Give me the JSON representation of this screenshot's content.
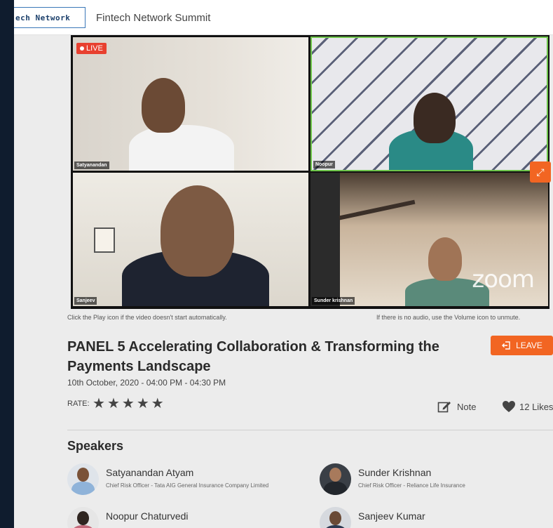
{
  "header": {
    "logo_text": "ech Network",
    "summit_title": "Fintech Network Summit"
  },
  "video": {
    "live_label": "LIVE",
    "zoom_watermark": "zoom",
    "tiles": [
      {
        "name": "Satyanandan"
      },
      {
        "name": "Noopur"
      },
      {
        "name": "Sanjeev"
      },
      {
        "name": "Sunder krishnan"
      }
    ],
    "active_speaker_color": "#6ec54a"
  },
  "hints": {
    "play": "Click the Play icon if the video doesn't start automatically.",
    "audio": "If there is no audio, use the Volume icon to unmute."
  },
  "session": {
    "title": "PANEL 5 Accelerating Collaboration & Transforming the Payments Landscape",
    "date": "10th October, 2020 - 04:00 PM - 04:30 PM",
    "leave_label": "LEAVE",
    "rate_label": "RATE:",
    "rating_stars": 5,
    "note_label": "Note",
    "likes_label": "12 Likes"
  },
  "speakers": {
    "heading": "Speakers",
    "items": [
      {
        "name": "Satyanandan Atyam",
        "role": "Chief Risk Officer - Tata AIG General Insurance Company Limited"
      },
      {
        "name": "Sunder Krishnan",
        "role": "Chief Risk Officer - Reliance Life Insurance"
      },
      {
        "name": "Noopur Chaturvedi",
        "role": ""
      },
      {
        "name": "Sanjeev Kumar",
        "role": ""
      }
    ]
  },
  "colors": {
    "accent": "#f26522",
    "sidebar": "#0f1c2e",
    "live": "#e8402f"
  }
}
